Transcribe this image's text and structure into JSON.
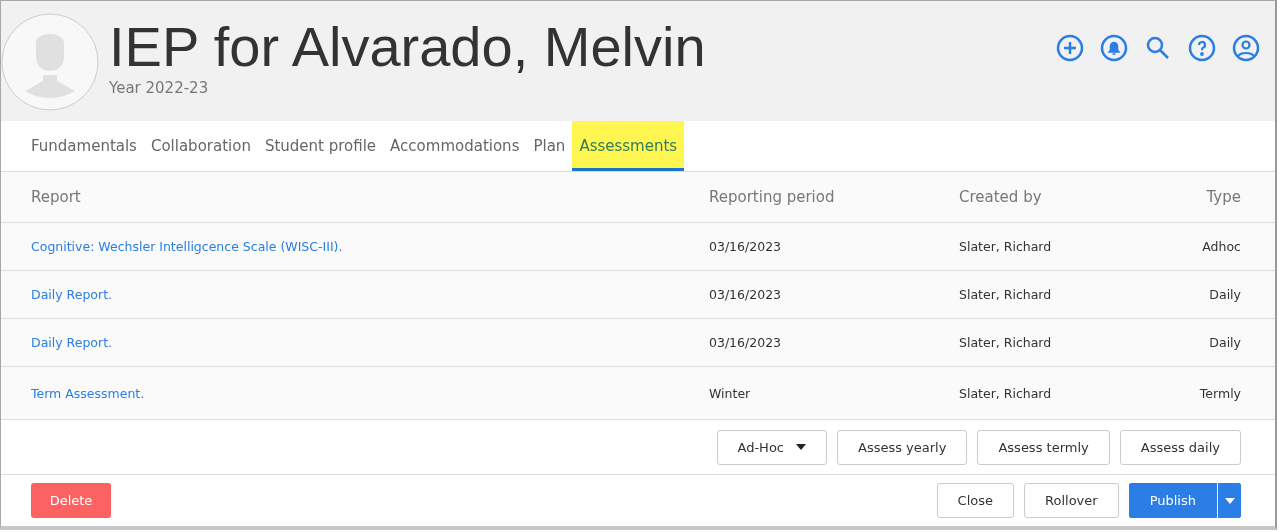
{
  "header": {
    "title": "IEP for Alvarado, Melvin",
    "subtitle": "Year 2022-23"
  },
  "tabs": [
    {
      "label": "Fundamentals",
      "selected": false,
      "highlighted": false
    },
    {
      "label": "Collaboration",
      "selected": false,
      "highlighted": false
    },
    {
      "label": "Student profile",
      "selected": false,
      "highlighted": false
    },
    {
      "label": "Accommodations",
      "selected": false,
      "highlighted": false
    },
    {
      "label": "Plan",
      "selected": false,
      "highlighted": false
    },
    {
      "label": "Assessments",
      "selected": true,
      "highlighted": true
    }
  ],
  "table": {
    "columns": [
      "Report",
      "Reporting period",
      "Created by",
      "Type"
    ],
    "rows": [
      [
        "Cognitive: Wechsler Intelligcence Scale (WISC-III).",
        "03/16/2023",
        "Slater, Richard",
        "Adhoc"
      ],
      [
        "Daily Report.",
        "03/16/2023",
        "Slater, Richard",
        "Daily"
      ],
      [
        "Daily Report.",
        "03/16/2023",
        "Slater, Richard",
        "Daily"
      ],
      [
        "Term Assessment.",
        "Winter",
        "Slater, Richard",
        "Termly"
      ]
    ]
  },
  "assess_buttons": [
    {
      "label": "Ad-Hoc",
      "kind": "dropdown"
    },
    {
      "label": "Assess yearly",
      "kind": "plain"
    },
    {
      "label": "Assess termly",
      "kind": "plain"
    },
    {
      "label": "Assess daily",
      "kind": "plain"
    }
  ],
  "footer": {
    "delete": "Delete",
    "close": "Close",
    "rollover": "Rollover",
    "publish": "Publish"
  }
}
